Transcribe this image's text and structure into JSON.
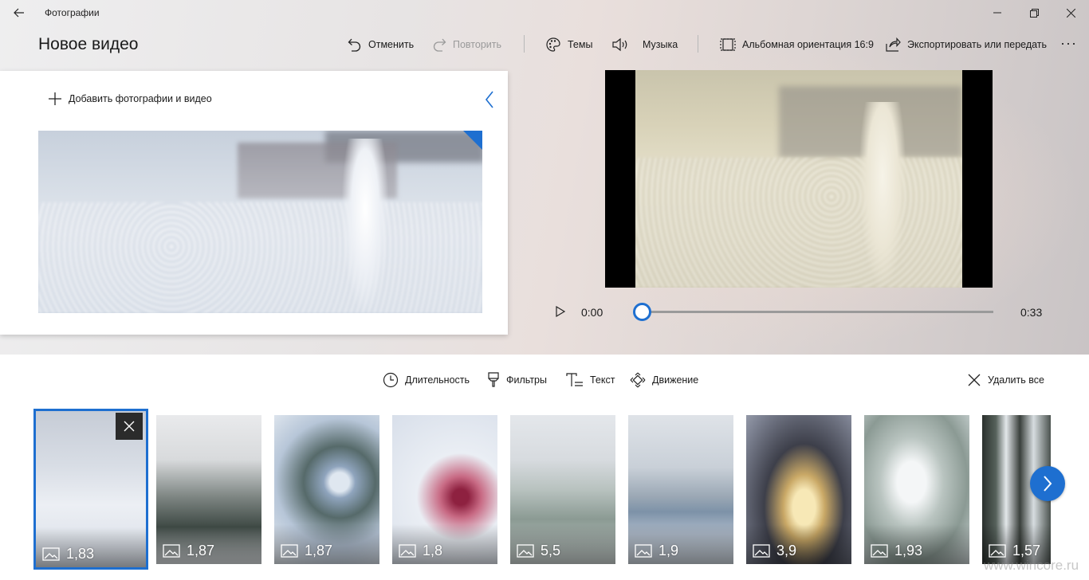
{
  "window": {
    "app_title": "Фотографии",
    "back_icon": "arrow-left-icon",
    "controls": [
      "minimize-icon",
      "maximize-icon",
      "close-icon"
    ]
  },
  "header": {
    "title": "Новое видео",
    "commands": {
      "undo": "Отменить",
      "redo": "Повторить",
      "themes": "Темы",
      "music": "Музыка",
      "aspect": "Альбомная ориентация 16:9",
      "export": "Экспортировать или передать",
      "more": "···"
    }
  },
  "library": {
    "add_label": "Добавить фотографии и видео"
  },
  "preview": {
    "current_time": "0:00",
    "total_time": "0:33",
    "progress": 0
  },
  "storyboard_toolbar": {
    "duration": "Длительность",
    "filters": "Фильтры",
    "text": "Текст",
    "motion": "Движение",
    "delete_all": "Удалить все"
  },
  "storyboard": {
    "cards": [
      {
        "duration": "1,83",
        "selected": true
      },
      {
        "duration": "1,87"
      },
      {
        "duration": "1,87"
      },
      {
        "duration": "1,8"
      },
      {
        "duration": "5,5"
      },
      {
        "duration": "1,9"
      },
      {
        "duration": "3,9"
      },
      {
        "duration": "1,93"
      },
      {
        "duration": "1,57"
      }
    ]
  },
  "watermark": "www.wincore.ru",
  "colors": {
    "accent": "#1e6fd0"
  }
}
